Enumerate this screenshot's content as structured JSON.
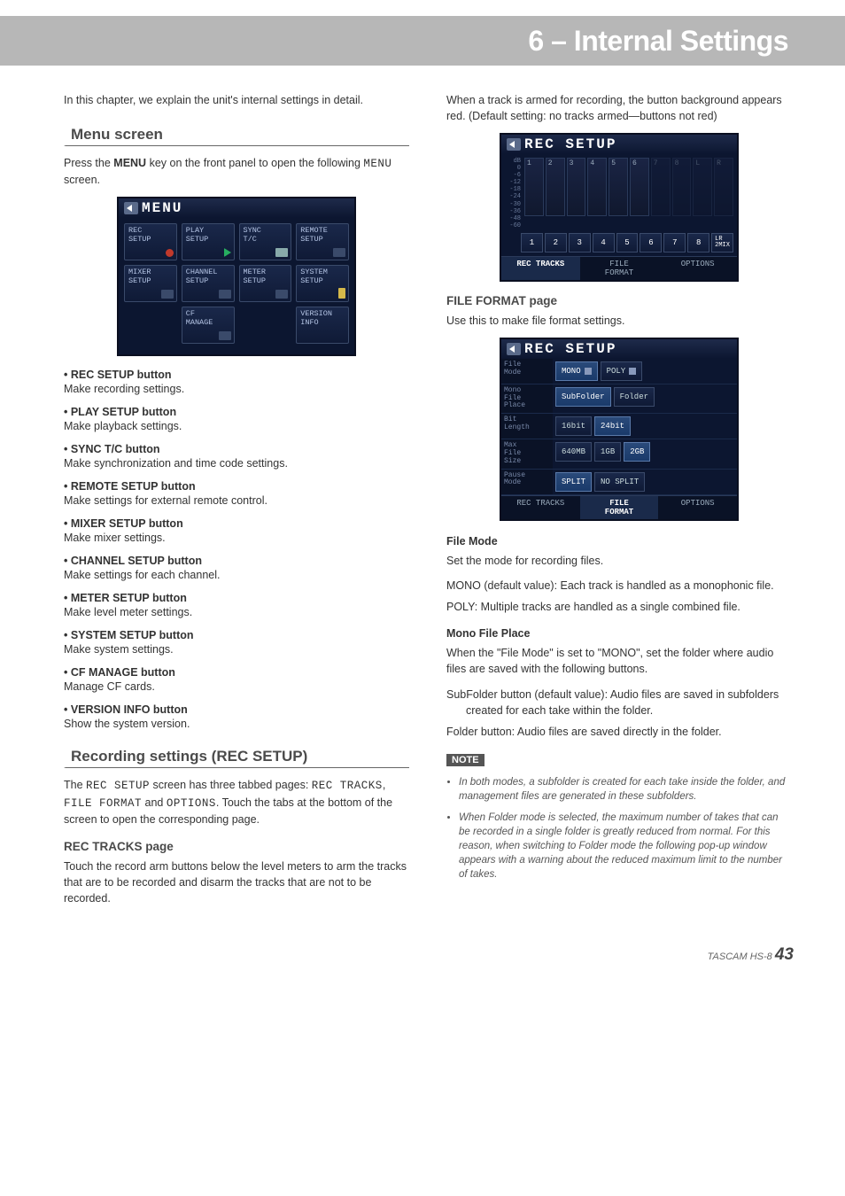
{
  "header": {
    "title": "6 – Internal Settings"
  },
  "left": {
    "intro": "In this chapter, we explain the unit's internal settings in detail.",
    "menu_screen": {
      "heading": "Menu screen",
      "para1_a": "Press the ",
      "para1_b": "MENU",
      "para1_c": " key on the front panel to open the following ",
      "para1_d": "MENU",
      "para1_e": " screen."
    },
    "menu_lcd": {
      "title": "MENU",
      "items": [
        {
          "label": "REC\nSETUP"
        },
        {
          "label": "PLAY\nSETUP"
        },
        {
          "label": "SYNC\nT/C"
        },
        {
          "label": "REMOTE\nSETUP"
        },
        {
          "label": "MIXER\nSETUP"
        },
        {
          "label": "CHANNEL\nSETUP"
        },
        {
          "label": "METER\nSETUP"
        },
        {
          "label": "SYSTEM\nSETUP"
        },
        {
          "label": ""
        },
        {
          "label": "CF\nMANAGE"
        },
        {
          "label": ""
        },
        {
          "label": "VERSION\nINFO"
        }
      ]
    },
    "menu_items": [
      {
        "head": "• REC SETUP button",
        "desc": "Make recording settings."
      },
      {
        "head": "• PLAY SETUP button",
        "desc": "Make playback settings."
      },
      {
        "head": "• SYNC T/C button",
        "desc": "Make synchronization and time code settings."
      },
      {
        "head": "• REMOTE SETUP button",
        "desc": "Make settings for external remote control."
      },
      {
        "head": "• MIXER SETUP button",
        "desc": "Make mixer settings."
      },
      {
        "head": "• CHANNEL SETUP button",
        "desc": "Make settings for each channel."
      },
      {
        "head": "• METER SETUP button",
        "desc": "Make level meter settings."
      },
      {
        "head": "• SYSTEM SETUP button",
        "desc": "Make system settings."
      },
      {
        "head": "• CF MANAGE button",
        "desc": "Manage CF cards."
      },
      {
        "head": "• VERSION INFO button",
        "desc": "Show the system version."
      }
    ],
    "rec_setup": {
      "heading": "Recording settings (REC SETUP)",
      "para_a": "The ",
      "para_b": "REC SETUP",
      "para_c": " screen has three tabbed pages: ",
      "para_d": "REC TRACKS",
      "para_e": ", ",
      "para_f": "FILE FORMAT",
      "para_g": " and ",
      "para_h": "OPTIONS",
      "para_i": ". Touch the tabs at the bottom of the screen to open the corresponding page."
    },
    "rec_tracks": {
      "heading": "REC TRACKS page",
      "para": "Touch the record arm buttons below the level meters to arm the tracks that are to be recorded and disarm the tracks that are not to be recorded."
    }
  },
  "right": {
    "intro": "When a track is armed for recording, the button background appears red. (Default setting: no tracks armed—buttons not red)",
    "tracks_lcd": {
      "title": "REC SETUP",
      "scale": [
        "dB",
        "0",
        "-6",
        "-12",
        "-18",
        "-24",
        "-30",
        "-36",
        "-48",
        "-60"
      ],
      "channels": [
        "1",
        "2",
        "3",
        "4",
        "5",
        "6",
        "7",
        "8",
        "L",
        "R"
      ],
      "arm": [
        "1",
        "2",
        "3",
        "4",
        "5",
        "6",
        "7",
        "8",
        "LR\n2MIX"
      ],
      "tabs": [
        "REC TRACKS",
        "FILE\nFORMAT",
        "OPTIONS"
      ]
    },
    "file_format_page": {
      "heading": "FILE FORMAT page",
      "para": "Use this to make file format settings."
    },
    "ff_lcd": {
      "title": "REC SETUP",
      "rows": [
        {
          "label": "File\nMode",
          "opts": [
            "MONO",
            "POLY"
          ],
          "sel": 0
        },
        {
          "label": "Mono\nFile\nPlace",
          "opts": [
            "SubFolder",
            "Folder"
          ],
          "sel": 0
        },
        {
          "label": "Bit\nLength",
          "opts": [
            "16bit",
            "24bit"
          ],
          "sel": 1
        },
        {
          "label": "Max\nFile\nSize",
          "opts": [
            "640MB",
            "1GB",
            "2GB"
          ],
          "sel": 2
        },
        {
          "label": "Pause\nMode",
          "opts": [
            "SPLIT",
            "NO SPLIT"
          ],
          "sel": 0
        }
      ],
      "tabs": [
        "REC TRACKS",
        "FILE\nFORMAT",
        "OPTIONS"
      ]
    },
    "file_mode": {
      "head": "File Mode",
      "p1": "Set the mode for recording files.",
      "mono": "MONO (default value): Each track is handled as a monophonic file.",
      "poly": "POLY: Multiple tracks are handled as a single combined file."
    },
    "mono_place": {
      "head": "Mono File Place",
      "p1": "When the \"File Mode\" is set to \"MONO\", set the folder where audio files are saved with the following buttons.",
      "sub": "SubFolder button (default value): Audio files are saved in subfolders created for each take within the folder.",
      "fol": "Folder button: Audio files are saved directly in the folder."
    },
    "note": {
      "tag": "NOTE",
      "n1": "In both modes, a subfolder is created for each take inside the folder, and management files are generated in these subfolders.",
      "n2": "When Folder mode is selected, the maximum number of takes that can be recorded in a single folder is greatly reduced from normal. For this reason, when switching to Folder mode the following pop-up window appears with a warning about the reduced maximum limit to the number of takes."
    }
  },
  "footer": {
    "model": "TASCAM  HS-8",
    "page": "43"
  }
}
